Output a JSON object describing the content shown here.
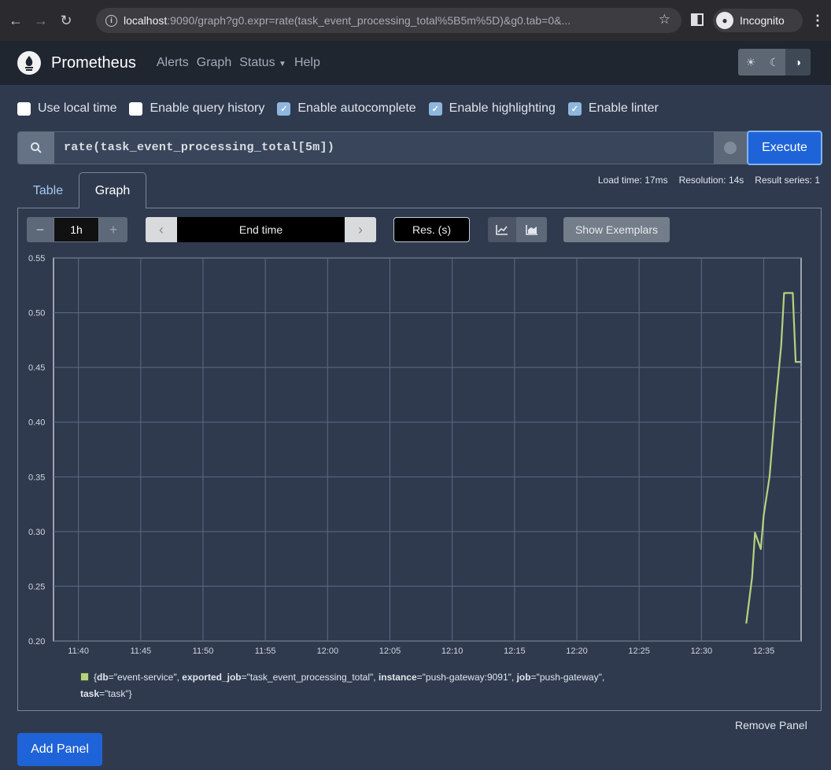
{
  "browser": {
    "url_host": "localhost",
    "url_rest": ":9090/graph?g0.expr=rate(task_event_processing_total%5B5m%5D)&g0.tab=0&...",
    "incognito_label": "Incognito"
  },
  "navbar": {
    "brand": "Prometheus",
    "links": [
      "Alerts",
      "Graph",
      "Status",
      "Help"
    ]
  },
  "options": [
    {
      "label": "Use local time",
      "checked": false
    },
    {
      "label": "Enable query history",
      "checked": false
    },
    {
      "label": "Enable autocomplete",
      "checked": true
    },
    {
      "label": "Enable highlighting",
      "checked": true
    },
    {
      "label": "Enable linter",
      "checked": true
    }
  ],
  "query": {
    "expression": "rate(task_event_processing_total[5m])",
    "execute_label": "Execute"
  },
  "stats": {
    "load_time": "Load time: 17ms",
    "resolution": "Resolution: 14s",
    "result_series": "Result series: 1"
  },
  "tabs": {
    "table": "Table",
    "graph": "Graph"
  },
  "controls": {
    "range_minus": "−",
    "range_value": "1h",
    "range_plus": "+",
    "end_prev": "‹",
    "end_time": "End time",
    "end_next": "›",
    "resolution": "Res. (s)",
    "show_exemplars": "Show Exemplars"
  },
  "chart_data": {
    "type": "line",
    "x_ticks": [
      "11:40",
      "11:45",
      "11:50",
      "11:55",
      "12:00",
      "12:05",
      "12:10",
      "12:15",
      "12:20",
      "12:25",
      "12:30",
      "12:35"
    ],
    "y_ticks": [
      "0.55",
      "0.50",
      "0.45",
      "0.40",
      "0.35",
      "0.30",
      "0.25",
      "0.20"
    ],
    "ylim": [
      0.2,
      0.55
    ],
    "xlim": [
      "11:38:00",
      "12:38:00"
    ],
    "grid": true,
    "series": [
      {
        "color": "#b5d37f",
        "x": [
          "12:33:36",
          "12:34:04",
          "12:34:18",
          "12:34:46",
          "12:35:00",
          "12:35:28",
          "12:35:56",
          "12:36:24",
          "12:36:38",
          "12:37:20",
          "12:37:34",
          "12:38:00"
        ],
        "values": [
          0.216,
          0.258,
          0.299,
          0.284,
          0.315,
          0.35,
          0.414,
          0.47,
          0.518,
          0.518,
          0.455,
          0.455
        ]
      }
    ]
  },
  "legend": {
    "db_key": "db",
    "db_val": "\"event-service\"",
    "exported_job_key": "exported_job",
    "exported_job_val": "\"task_event_processing_total\"",
    "instance_key": "instance",
    "instance_val": "\"push-gateway:9091\"",
    "job_key": "job",
    "job_val": "\"push-gateway\"",
    "task_key": "task",
    "task_val": "\"task\""
  },
  "remove_panel": "Remove Panel",
  "add_panel": "Add Panel"
}
